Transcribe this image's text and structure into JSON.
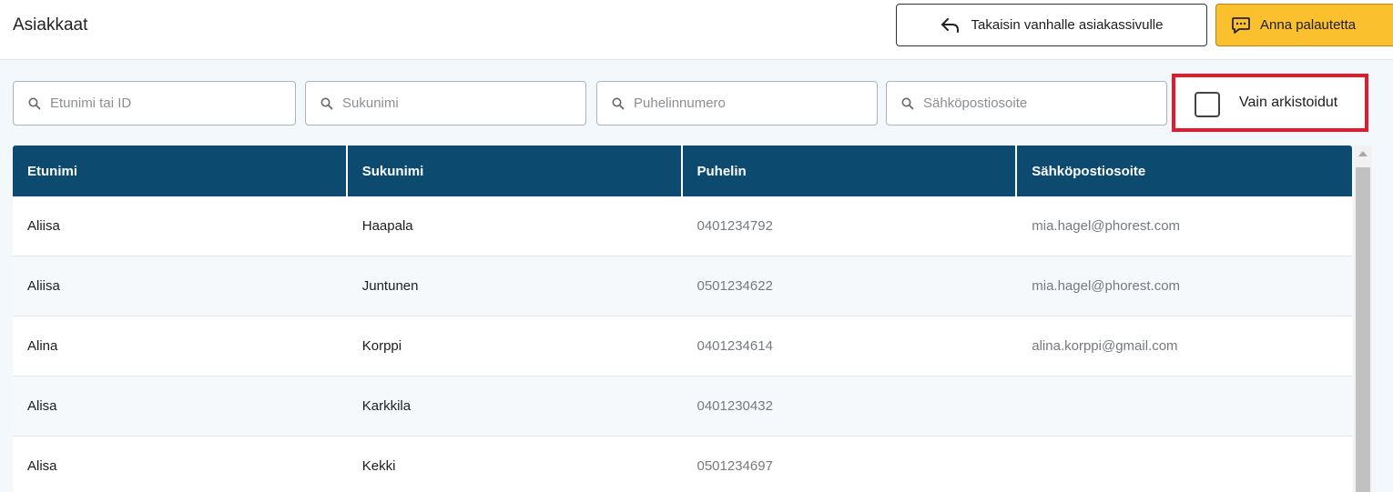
{
  "header": {
    "title": "Asiakkaat",
    "back_button_label": "Takaisin vanhalle asiakassivulle",
    "feedback_button_label": "Anna palautetta",
    "accent_color": "#fbc02d"
  },
  "filters": {
    "first_name_placeholder": "Etunimi tai ID",
    "last_name_placeholder": "Sukunimi",
    "phone_placeholder": "Puhelinnumero",
    "email_placeholder": "Sähköpostiosoite",
    "archived_only_label": "Vain arkistoidut",
    "archived_only_checked": false
  },
  "table": {
    "header_color": "#0d4a6f",
    "columns": [
      "Etunimi",
      "Sukunimi",
      "Puhelin",
      "Sähköpostiosoite"
    ],
    "rows": [
      [
        "Aliisa",
        "Haapala",
        "0401234792",
        "mia.hagel@phorest.com"
      ],
      [
        "Aliisa",
        "Juntunen",
        "0501234622",
        "mia.hagel@phorest.com"
      ],
      [
        "Alina",
        "Korppi",
        "0401234614",
        "alina.korppi@gmail.com"
      ],
      [
        "Alisa",
        "Karkkila",
        "0401230432",
        ""
      ],
      [
        "Alisa",
        "Kekki",
        "0501234697",
        ""
      ]
    ]
  }
}
